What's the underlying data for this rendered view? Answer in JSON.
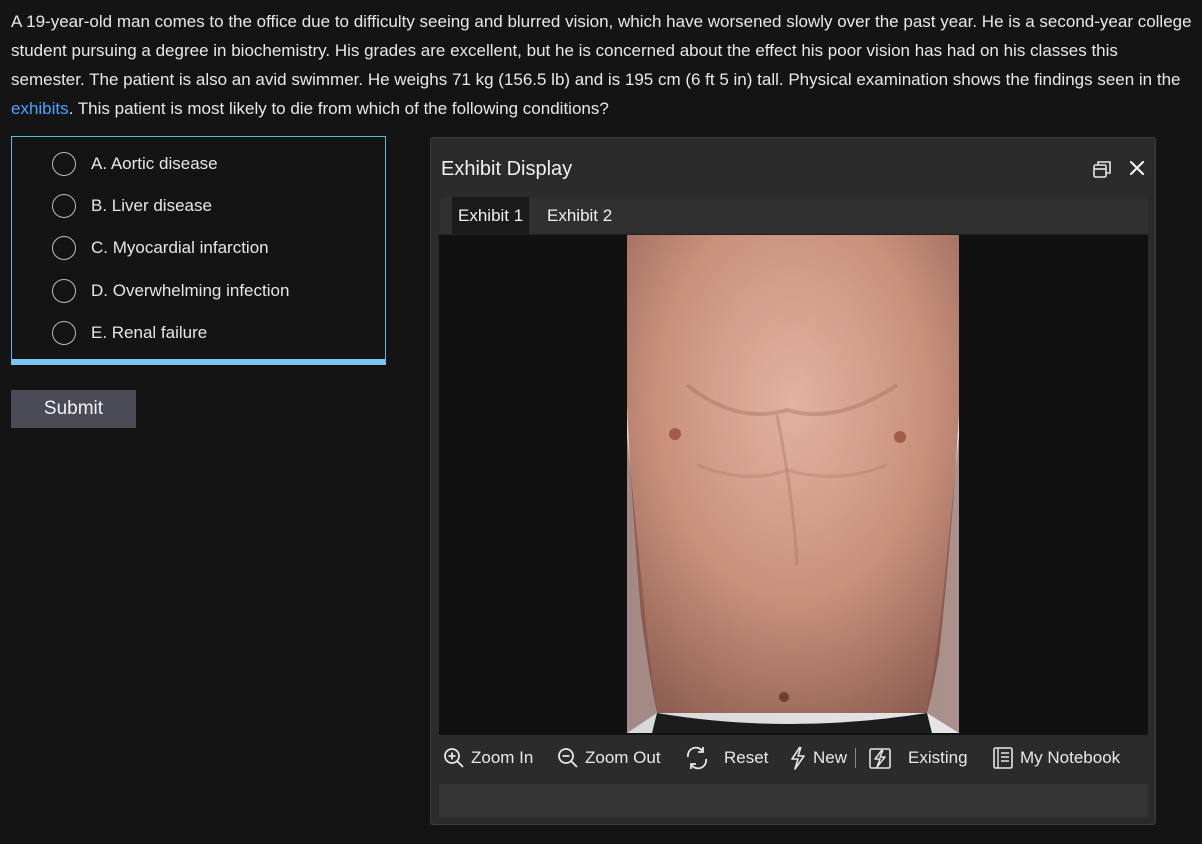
{
  "question": {
    "text_before_link": "A 19-year-old man comes to the office due to difficulty seeing and blurred vision, which have worsened slowly over the past year.  He is a second-year college student pursuing a degree in biochemistry.  His grades are excellent, but he is concerned about the effect his poor vision has had on his classes this semester.  The patient is also an avid swimmer.  He weighs 71 kg (156.5 lb) and is 195 cm (6 ft 5 in) tall.  Physical examination shows the findings seen in the ",
    "link_text": "exhibits",
    "text_after_link": ".  This patient is most likely to die from which of the following conditions?"
  },
  "choices": [
    {
      "label": "A.  Aortic disease"
    },
    {
      "label": "B.  Liver disease"
    },
    {
      "label": "C.  Myocardial infarction"
    },
    {
      "label": "D.  Overwhelming infection"
    },
    {
      "label": "E.  Renal failure"
    }
  ],
  "submit_label": "Submit",
  "exhibit_panel": {
    "title": "Exhibit Display",
    "tabs": [
      {
        "label": "Exhibit 1",
        "active": true
      },
      {
        "label": "Exhibit 2",
        "active": false
      }
    ],
    "toolbar": {
      "zoom_in": "Zoom In",
      "zoom_out": "Zoom Out",
      "reset": "Reset",
      "new": "New",
      "existing": "Existing",
      "notebook": "My Notebook"
    },
    "icons": [
      "restore-window-icon",
      "close-icon",
      "zoom-in-icon",
      "zoom-out-icon",
      "reset-icon",
      "new-lightning-icon",
      "existing-note-icon",
      "notebook-icon"
    ]
  },
  "colors": {
    "background": "#141414",
    "link": "#4aa3ff",
    "choice_border": "#5fb4e8",
    "submit_bg": "#4b4a57",
    "panel_bg": "#2b2b2b"
  }
}
